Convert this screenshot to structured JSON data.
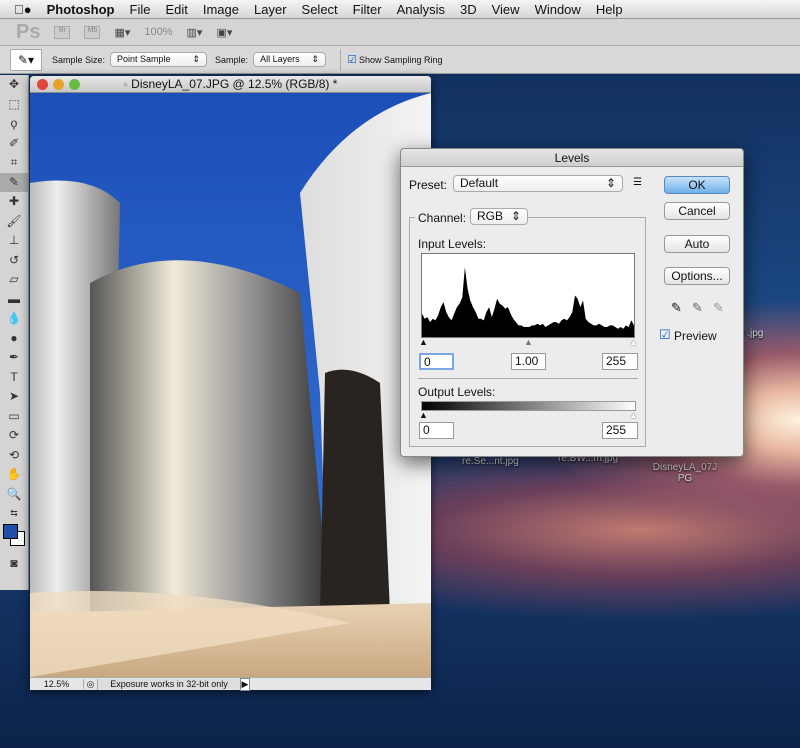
{
  "menubar": {
    "apple": "",
    "items": [
      "Photoshop",
      "File",
      "Edit",
      "Image",
      "Layer",
      "Select",
      "Filter",
      "Analysis",
      "3D",
      "View",
      "Window",
      "Help"
    ]
  },
  "appbar": {
    "logo": "Ps",
    "bridge": "Br",
    "minibridge": "Mb",
    "zoom": "100%"
  },
  "options": {
    "sample_size_label": "Sample Size:",
    "sample_size_value": "Point Sample",
    "sample_label": "Sample:",
    "sample_value": "All Layers",
    "show_ring_label": "Show Sampling Ring",
    "show_ring_checked": true
  },
  "document": {
    "title": "DisneyLA_07.JPG @ 12.5% (RGB/8) *",
    "zoom": "12.5%",
    "status": "Exposure works in 32-bit only"
  },
  "levels": {
    "title": "Levels",
    "preset_label": "Preset:",
    "preset_value": "Default",
    "channel_label": "Channel:",
    "channel_value": "RGB",
    "input_label": "Input Levels:",
    "input_black": "0",
    "input_gamma": "1.00",
    "input_white": "255",
    "output_label": "Output Levels:",
    "output_black": "0",
    "output_white": "255",
    "buttons": {
      "ok": "OK",
      "cancel": "Cancel",
      "auto": "Auto",
      "options": "Options..."
    },
    "preview_label": "Preview",
    "preview_checked": true,
    "histogram": [
      28,
      22,
      24,
      18,
      22,
      20,
      26,
      36,
      42,
      30,
      24,
      20,
      28,
      36,
      40,
      48,
      84,
      58,
      44,
      36,
      30,
      22,
      22,
      20,
      30,
      36,
      24,
      34,
      46,
      40,
      38,
      34,
      36,
      28,
      22,
      18,
      14,
      14,
      12,
      12,
      12,
      14,
      14,
      16,
      14,
      16,
      12,
      14,
      16,
      18,
      18,
      16,
      20,
      22,
      20,
      24,
      30,
      50,
      46,
      36,
      44,
      22,
      18,
      16,
      14,
      14,
      16,
      14,
      12,
      12,
      14,
      14,
      12,
      10,
      12,
      10,
      14,
      12,
      20,
      14
    ]
  },
  "desktop": {
    "icons": [
      "er0\n.jpg",
      "re.Se...nt.jpg",
      "re.BW...m.jpg",
      "DisneyLA_07J\nPG"
    ]
  },
  "colors": {
    "foreground": "#1f4fa8",
    "background": "#ffffff",
    "ok_button": "#6fb0ea"
  }
}
